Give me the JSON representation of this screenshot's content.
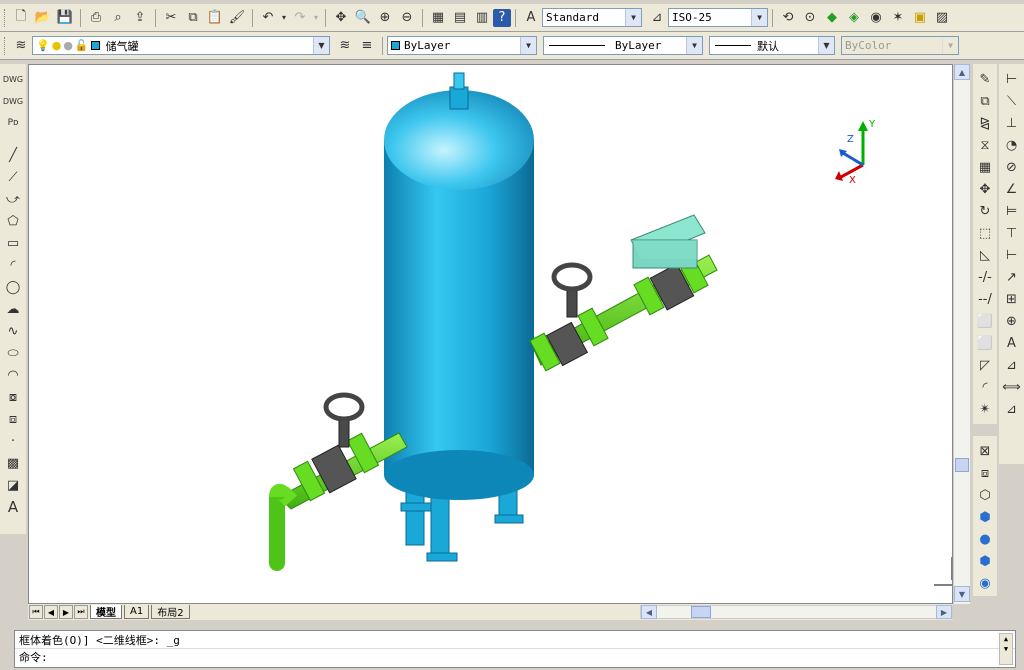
{
  "toolbar1": {
    "text_style": "Standard",
    "dim_style": "ISO-25"
  },
  "toolbar2": {
    "layer_name": "储气罐",
    "color": "ByLayer",
    "linetype": "ByLayer",
    "lineweight": "默认",
    "plotstyle": "ByColor"
  },
  "ucs": {
    "x": "X",
    "y": "Y",
    "z": "Z"
  },
  "layout_tabs": [
    {
      "label": "模型",
      "active": true
    },
    {
      "label": "A1",
      "active": false
    },
    {
      "label": "布局2",
      "active": false
    }
  ],
  "command": {
    "history": "框体着色(O)] <二维线框>: _g",
    "prompt": "命令:"
  },
  "colors": {
    "tank": "#19a8d8",
    "pipe": "#66dd22",
    "valve": "#4a4a4a",
    "actuator": "#8de6d0"
  }
}
